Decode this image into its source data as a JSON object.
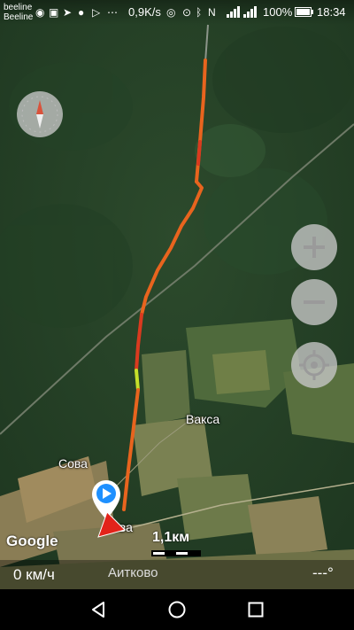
{
  "status_bar": {
    "carrier_1": "beeline",
    "carrier_2": "Beeline",
    "speed": "0,9K/s",
    "battery": "100%",
    "time": "18:34",
    "icons": [
      "vk-icon",
      "telegram-icon",
      "chat-icon",
      "send-icon",
      "more-icon",
      "hotspot-icon",
      "location-icon",
      "bluetooth-icon",
      "nfc-icon",
      "signal-icon",
      "battery-icon"
    ]
  },
  "map": {
    "labels": {
      "place_vaksa": "Вакса",
      "place_sova": "Сова",
      "place_sova_2": "ова",
      "place_aitkovo": "Аитково"
    },
    "google_logo": "Google",
    "scale_text": "1,1км"
  },
  "controls": {
    "zoom_in": "+",
    "zoom_out": "−"
  },
  "bottom": {
    "speed": "0 км/ч",
    "heading": "---°"
  },
  "colors": {
    "track_red": "#d93a1f",
    "track_orange": "#e8641e",
    "track_yellow": "#c6e02a",
    "marker_blue": "#1e90ff",
    "arrow_red": "#e2231a"
  }
}
